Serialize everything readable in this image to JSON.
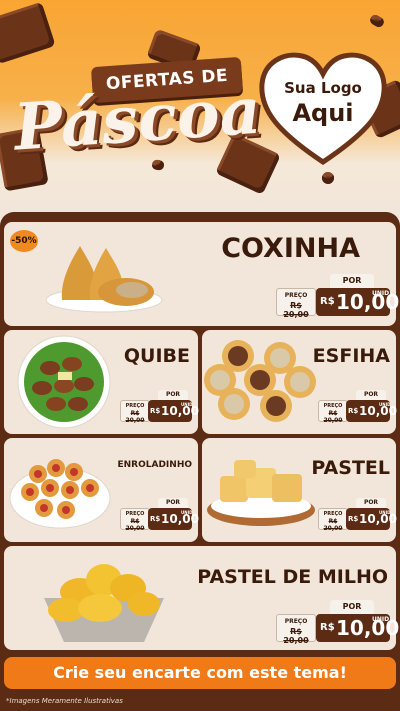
{
  "header": {
    "title_top": "OFERTAS DE",
    "title_main": "Páscoa",
    "logo_line1": "Sua Logo",
    "logo_line2": "Aqui"
  },
  "badge": "-50%",
  "price_labels": {
    "before": "PREÇO",
    "por": "POR",
    "unit": "UNID",
    "currency": "R$"
  },
  "products": {
    "coxinha": {
      "name": "COXINHA",
      "old_price": "R$ 20,00",
      "price": "10,00"
    },
    "quibe": {
      "name": "QUIBE",
      "old_price": "R$ 20,00",
      "price": "10,00"
    },
    "esfiha": {
      "name": "ESFIHA",
      "old_price": "R$ 20,00",
      "price": "10,00"
    },
    "enroladinho": {
      "name": "ENROLADINHO",
      "old_price": "R$ 20,00",
      "price": "10,00"
    },
    "pastel": {
      "name": "PASTEL",
      "old_price": "R$ 20,00",
      "price": "10,00"
    },
    "pastel_milho": {
      "name": "PASTEL DE MILHO",
      "old_price": "R$ 20,00",
      "price": "10,00"
    }
  },
  "cta": "Crie seu encarte com este tema!",
  "disclaimer": "*Imagens Meramente Ilustrativas",
  "colors": {
    "brown": "#5b2b14",
    "orange": "#f07a18",
    "cream": "#f1e6d9"
  }
}
